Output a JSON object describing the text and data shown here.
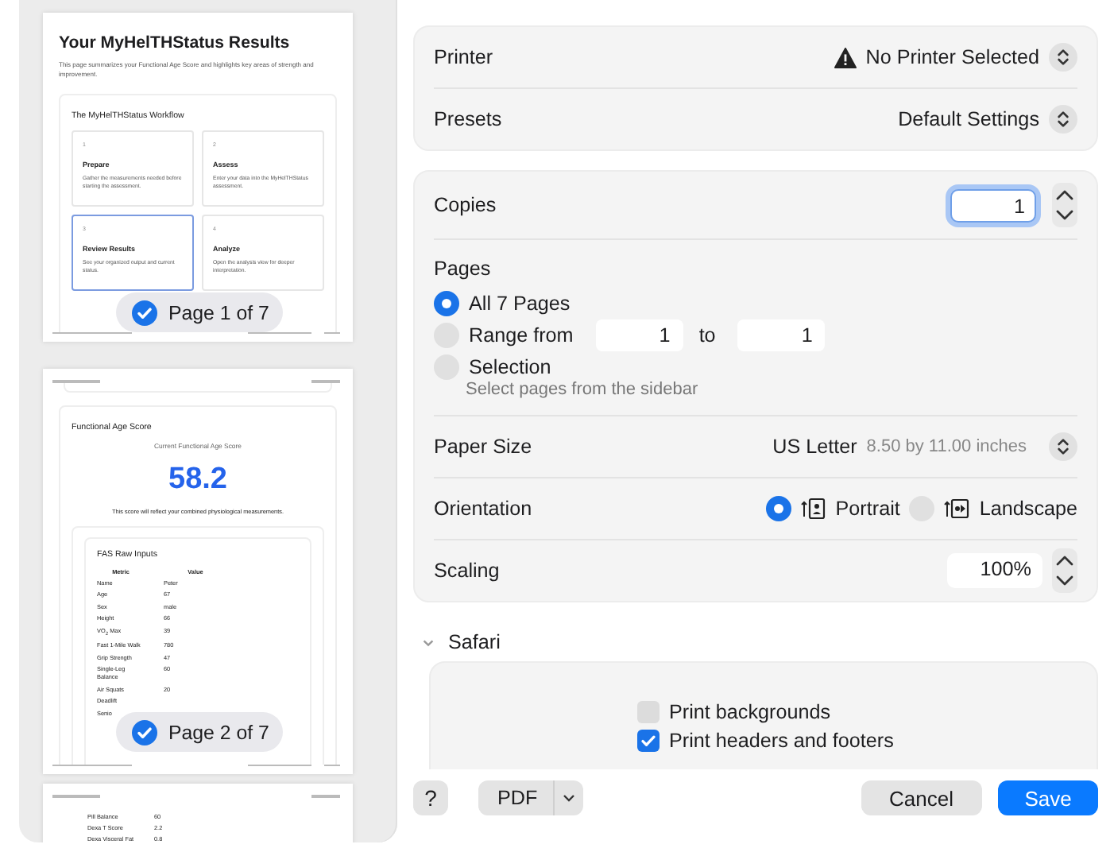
{
  "sidebar": {
    "pages": [
      {
        "kind": "workflow",
        "title": "Your MyHelTHStatus Results",
        "intro": "This page summarizes your Functional Age Score and highlights key areas of strength and improvement.",
        "section_title": "The MyHelTHStatus Workflow",
        "steps": [
          {
            "number": "1",
            "title": "Prepare",
            "text": "Gather the measurements needed before starting the assessment.",
            "selected": false
          },
          {
            "number": "2",
            "title": "Assess",
            "text": "Enter your data into the MyHelTHStatus assessment.",
            "selected": false
          },
          {
            "number": "3",
            "title": "Review Results",
            "text": "See your organized output and current status.",
            "selected": true
          },
          {
            "number": "4",
            "title": "Analyze",
            "text": "Open the analysis view for deeper interpretation.",
            "selected": false
          }
        ],
        "badge": {
          "label": "Page 1 of 7",
          "checked": true
        }
      },
      {
        "kind": "score",
        "section_title": "Functional Age Score",
        "score_label": "Current Functional Age Score",
        "score": "58.2",
        "note": "This score will reflect your combined physiological measurements.",
        "table_title": "FAS Raw Inputs",
        "columns": [
          "Metric",
          "Value"
        ],
        "rows": [
          [
            "Name",
            "Peter"
          ],
          [
            "Age",
            "67"
          ],
          [
            "Sex",
            "male"
          ],
          [
            "Height",
            "66"
          ],
          [
            "VO$_{2}$ Max",
            "39"
          ],
          [
            "Fast 1-Mile Walk",
            "780"
          ],
          [
            "Grip Strength",
            "47"
          ],
          [
            "Single-Leg Balance",
            "60"
          ],
          [
            "Air Squats",
            "20"
          ],
          [
            "Deadlift"
          ],
          [
            "Senio"
          ]
        ],
        "badge": {
          "label": "Page 2 of 7",
          "checked": true
        }
      },
      {
        "kind": "table",
        "rows": [
          [
            "Pill Balance",
            "60"
          ],
          [
            "Dexa T Score",
            "2.2"
          ],
          [
            "Dexa Visceral Fat",
            "0.8"
          ]
        ]
      }
    ]
  },
  "printer": {
    "label": "Printer",
    "value": "No Printer Selected",
    "warning": true
  },
  "presets": {
    "label": "Presets",
    "value": "Default Settings"
  },
  "copies": {
    "label": "Copies",
    "value": "1",
    "focused": true
  },
  "pages": {
    "label": "Pages",
    "options": [
      {
        "kind": "plain",
        "label": "All 7 Pages",
        "selected": true
      },
      {
        "kind": "range",
        "label": "Range from",
        "selected": false,
        "from": "1",
        "to_label": "to",
        "to": "1"
      },
      {
        "kind": "plain",
        "label": "Selection",
        "selected": false,
        "hint": "Select pages from the sidebar"
      }
    ]
  },
  "paper_size": {
    "label": "Paper Size",
    "value": "US Letter",
    "detail": "8.50 by 11.00 inches"
  },
  "orientation": {
    "label": "Orientation",
    "options": [
      {
        "kind": "portrait",
        "label": "Portrait",
        "selected": true
      },
      {
        "kind": "landscape",
        "label": "Landscape",
        "selected": false
      }
    ]
  },
  "scaling": {
    "label": "Scaling",
    "value": "100%"
  },
  "safari": {
    "label": "Safari",
    "expanded": true,
    "options": [
      {
        "label": "Print backgrounds",
        "checked": false
      },
      {
        "label": "Print headers and footers",
        "checked": true
      }
    ]
  },
  "footer": {
    "help": "?",
    "pdf": "PDF",
    "cancel": "Cancel",
    "save": "Save"
  }
}
